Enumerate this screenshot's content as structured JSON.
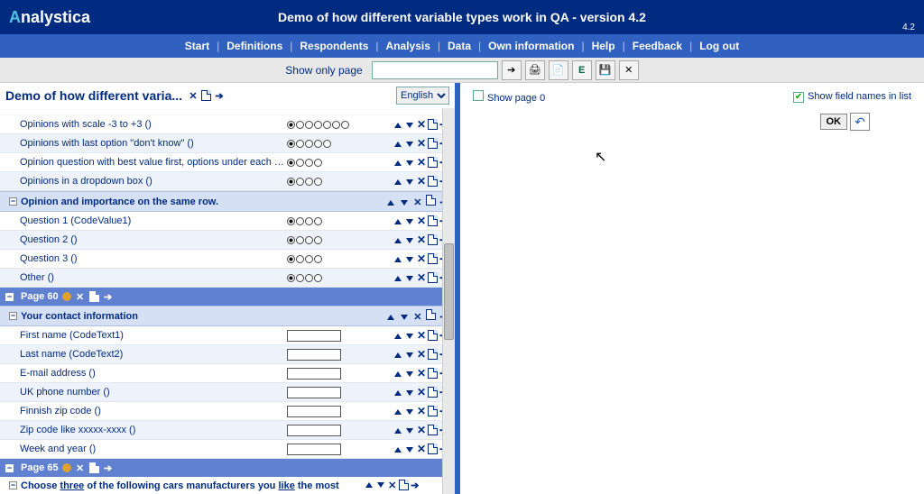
{
  "brand": {
    "a": "A",
    "rest": "nalystica"
  },
  "header": {
    "title": "Demo of how different variable types work in QA - version 4.2",
    "version": "4.2"
  },
  "menu": [
    "Start",
    "Definitions",
    "Respondents",
    "Analysis",
    "Data",
    "Own information",
    "Help",
    "Feedback",
    "Log out"
  ],
  "toolbar": {
    "label": "Show only page",
    "value": ""
  },
  "left": {
    "title": "Demo of how different varia...",
    "lang": "English",
    "rows_a": [
      {
        "label": "Opinions with scale -3 to +3 ()",
        "dots": 7
      },
      {
        "label": "Opinions with last option \"don't know\" ()",
        "dots": 5
      },
      {
        "label": "Opinion question with best value first, options under each other ()",
        "dots": 4
      },
      {
        "label": "Opinions in a dropdown box ()",
        "dots": 4
      }
    ],
    "group_b": "Opinion and importance on the same row.",
    "rows_b": [
      {
        "label": "Question 1 (CodeValue1)",
        "dots": 4
      },
      {
        "label": "Question 2 ()",
        "dots": 4
      },
      {
        "label": "Question 3 ()",
        "dots": 4
      },
      {
        "label": "Other ()",
        "dots": 4
      }
    ],
    "page60": "Page 60",
    "group_c": "Your contact information",
    "rows_c": [
      {
        "label": "First name (CodeText1)"
      },
      {
        "label": "Last name (CodeText2)"
      },
      {
        "label": "E-mail address ()"
      },
      {
        "label": "UK phone number ()"
      },
      {
        "label": "Finnish zip code ()"
      },
      {
        "label": "Zip code like xxxxx-xxxx ()"
      },
      {
        "label": "Week and year ()"
      }
    ],
    "page65": "Page 65",
    "group_d_pre": "Choose ",
    "group_d_u1": "three",
    "group_d_mid": " of the following cars manufacturers you ",
    "group_d_u2": "like",
    "group_d_post": " the most"
  },
  "right": {
    "show_page": "Show page 0",
    "show_fields": "Show field names in list",
    "ok": "OK"
  }
}
